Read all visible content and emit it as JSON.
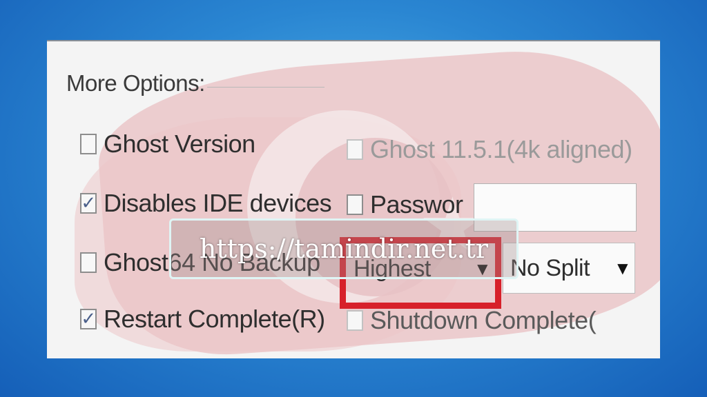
{
  "section": {
    "title": "More Options:"
  },
  "options": [
    {
      "label": "Ghost Version",
      "checked": false,
      "enabled": true
    },
    {
      "label": "Disables IDE devices",
      "checked": true,
      "enabled": true
    },
    {
      "label": "Ghost64 No Backup",
      "checked": false,
      "enabled": true
    },
    {
      "label": "Restart Complete(R)",
      "checked": true,
      "enabled": true
    },
    {
      "label": "Ghost 11.5.1(4k aligned)",
      "checked": false,
      "enabled": false
    },
    {
      "label": "Passwor",
      "checked": false,
      "enabled": true
    },
    {
      "label": "Shutdown Complete(",
      "checked": false,
      "enabled": false
    }
  ],
  "password": {
    "value": ""
  },
  "compression": {
    "selected": "Highest"
  },
  "split": {
    "selected": "No Split"
  },
  "check_glyph": "✓",
  "caret_glyph": "▼",
  "watermark": {
    "text": "https://tamindir.net.tr"
  },
  "colors": {
    "highlight": "#d7202a",
    "background": "#2a86d2"
  }
}
